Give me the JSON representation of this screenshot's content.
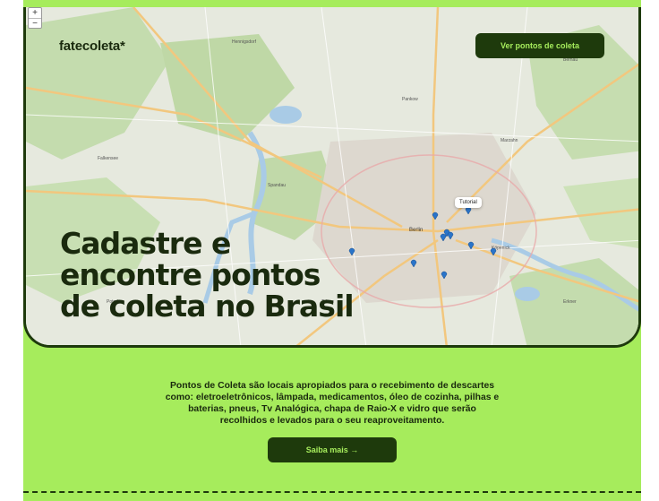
{
  "brand": {
    "name": "fatecoleta*"
  },
  "header": {
    "nav_button": "Ver pontos de coleta"
  },
  "map": {
    "zoom_in": "+",
    "zoom_out": "−",
    "tooltip": "Tutorial",
    "city_label": "Berlin",
    "colors": {
      "land": "#e9ede2",
      "forest": "#b9d7a0",
      "water": "#a9cbe6",
      "road": "#f2c77e",
      "marker": "#2a74c9"
    }
  },
  "hero": {
    "headline_lines": [
      "Cadastre e",
      "encontre pontos",
      "de coleta no Brasil"
    ]
  },
  "info": {
    "description": "Pontos de Coleta são locais apropiados para o recebimento de descartes como: eletroeletrônicos, lâmpada, medicamentos, óleo de cozinha, pilhas e baterias, pneus, Tv Analógica, chapa de Raio-X e vidro que serão recolhidos e levados para o seu reaproveitamento.",
    "cta": "Saiba mais →"
  },
  "colors": {
    "accent_green": "#a6ec5c",
    "dark_green": "#1e3a0c"
  }
}
